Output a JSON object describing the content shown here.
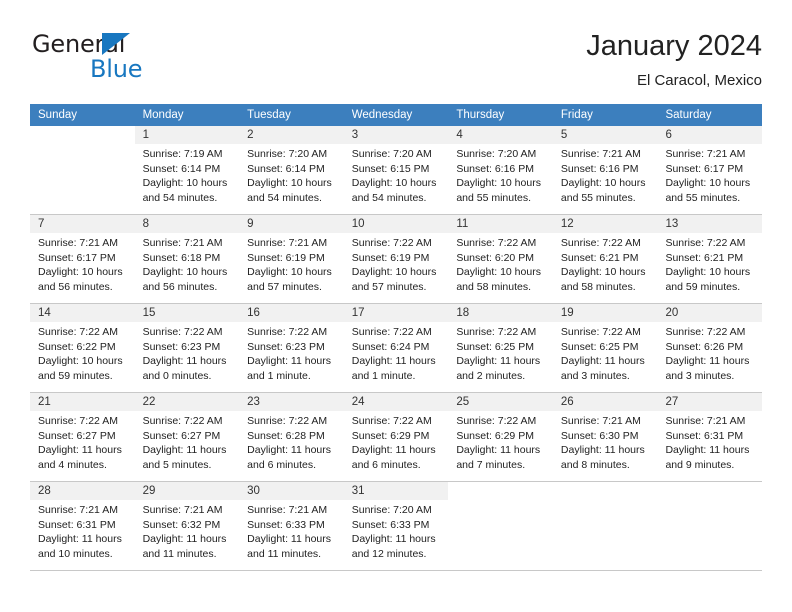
{
  "brand": {
    "word_one": "General",
    "word_two": "Blue",
    "accent_color": "#1877c0",
    "dark_color": "#231f20"
  },
  "header": {
    "title": "January 2024",
    "subtitle": "El Caracol, Mexico",
    "header_bg_color": "#3c7fbe",
    "daynum_bg_color": "#f1f1f1"
  },
  "weekdays": [
    "Sunday",
    "Monday",
    "Tuesday",
    "Wednesday",
    "Thursday",
    "Friday",
    "Saturday"
  ],
  "weeks": [
    [
      {
        "day": "",
        "sunrise": "",
        "sunset": "",
        "daylight1": "",
        "daylight2": ""
      },
      {
        "day": "1",
        "sunrise": "Sunrise: 7:19 AM",
        "sunset": "Sunset: 6:14 PM",
        "daylight1": "Daylight: 10 hours",
        "daylight2": "and 54 minutes."
      },
      {
        "day": "2",
        "sunrise": "Sunrise: 7:20 AM",
        "sunset": "Sunset: 6:14 PM",
        "daylight1": "Daylight: 10 hours",
        "daylight2": "and 54 minutes."
      },
      {
        "day": "3",
        "sunrise": "Sunrise: 7:20 AM",
        "sunset": "Sunset: 6:15 PM",
        "daylight1": "Daylight: 10 hours",
        "daylight2": "and 54 minutes."
      },
      {
        "day": "4",
        "sunrise": "Sunrise: 7:20 AM",
        "sunset": "Sunset: 6:16 PM",
        "daylight1": "Daylight: 10 hours",
        "daylight2": "and 55 minutes."
      },
      {
        "day": "5",
        "sunrise": "Sunrise: 7:21 AM",
        "sunset": "Sunset: 6:16 PM",
        "daylight1": "Daylight: 10 hours",
        "daylight2": "and 55 minutes."
      },
      {
        "day": "6",
        "sunrise": "Sunrise: 7:21 AM",
        "sunset": "Sunset: 6:17 PM",
        "daylight1": "Daylight: 10 hours",
        "daylight2": "and 55 minutes."
      }
    ],
    [
      {
        "day": "7",
        "sunrise": "Sunrise: 7:21 AM",
        "sunset": "Sunset: 6:17 PM",
        "daylight1": "Daylight: 10 hours",
        "daylight2": "and 56 minutes."
      },
      {
        "day": "8",
        "sunrise": "Sunrise: 7:21 AM",
        "sunset": "Sunset: 6:18 PM",
        "daylight1": "Daylight: 10 hours",
        "daylight2": "and 56 minutes."
      },
      {
        "day": "9",
        "sunrise": "Sunrise: 7:21 AM",
        "sunset": "Sunset: 6:19 PM",
        "daylight1": "Daylight: 10 hours",
        "daylight2": "and 57 minutes."
      },
      {
        "day": "10",
        "sunrise": "Sunrise: 7:22 AM",
        "sunset": "Sunset: 6:19 PM",
        "daylight1": "Daylight: 10 hours",
        "daylight2": "and 57 minutes."
      },
      {
        "day": "11",
        "sunrise": "Sunrise: 7:22 AM",
        "sunset": "Sunset: 6:20 PM",
        "daylight1": "Daylight: 10 hours",
        "daylight2": "and 58 minutes."
      },
      {
        "day": "12",
        "sunrise": "Sunrise: 7:22 AM",
        "sunset": "Sunset: 6:21 PM",
        "daylight1": "Daylight: 10 hours",
        "daylight2": "and 58 minutes."
      },
      {
        "day": "13",
        "sunrise": "Sunrise: 7:22 AM",
        "sunset": "Sunset: 6:21 PM",
        "daylight1": "Daylight: 10 hours",
        "daylight2": "and 59 minutes."
      }
    ],
    [
      {
        "day": "14",
        "sunrise": "Sunrise: 7:22 AM",
        "sunset": "Sunset: 6:22 PM",
        "daylight1": "Daylight: 10 hours",
        "daylight2": "and 59 minutes."
      },
      {
        "day": "15",
        "sunrise": "Sunrise: 7:22 AM",
        "sunset": "Sunset: 6:23 PM",
        "daylight1": "Daylight: 11 hours",
        "daylight2": "and 0 minutes."
      },
      {
        "day": "16",
        "sunrise": "Sunrise: 7:22 AM",
        "sunset": "Sunset: 6:23 PM",
        "daylight1": "Daylight: 11 hours",
        "daylight2": "and 1 minute."
      },
      {
        "day": "17",
        "sunrise": "Sunrise: 7:22 AM",
        "sunset": "Sunset: 6:24 PM",
        "daylight1": "Daylight: 11 hours",
        "daylight2": "and 1 minute."
      },
      {
        "day": "18",
        "sunrise": "Sunrise: 7:22 AM",
        "sunset": "Sunset: 6:25 PM",
        "daylight1": "Daylight: 11 hours",
        "daylight2": "and 2 minutes."
      },
      {
        "day": "19",
        "sunrise": "Sunrise: 7:22 AM",
        "sunset": "Sunset: 6:25 PM",
        "daylight1": "Daylight: 11 hours",
        "daylight2": "and 3 minutes."
      },
      {
        "day": "20",
        "sunrise": "Sunrise: 7:22 AM",
        "sunset": "Sunset: 6:26 PM",
        "daylight1": "Daylight: 11 hours",
        "daylight2": "and 3 minutes."
      }
    ],
    [
      {
        "day": "21",
        "sunrise": "Sunrise: 7:22 AM",
        "sunset": "Sunset: 6:27 PM",
        "daylight1": "Daylight: 11 hours",
        "daylight2": "and 4 minutes."
      },
      {
        "day": "22",
        "sunrise": "Sunrise: 7:22 AM",
        "sunset": "Sunset: 6:27 PM",
        "daylight1": "Daylight: 11 hours",
        "daylight2": "and 5 minutes."
      },
      {
        "day": "23",
        "sunrise": "Sunrise: 7:22 AM",
        "sunset": "Sunset: 6:28 PM",
        "daylight1": "Daylight: 11 hours",
        "daylight2": "and 6 minutes."
      },
      {
        "day": "24",
        "sunrise": "Sunrise: 7:22 AM",
        "sunset": "Sunset: 6:29 PM",
        "daylight1": "Daylight: 11 hours",
        "daylight2": "and 6 minutes."
      },
      {
        "day": "25",
        "sunrise": "Sunrise: 7:22 AM",
        "sunset": "Sunset: 6:29 PM",
        "daylight1": "Daylight: 11 hours",
        "daylight2": "and 7 minutes."
      },
      {
        "day": "26",
        "sunrise": "Sunrise: 7:21 AM",
        "sunset": "Sunset: 6:30 PM",
        "daylight1": "Daylight: 11 hours",
        "daylight2": "and 8 minutes."
      },
      {
        "day": "27",
        "sunrise": "Sunrise: 7:21 AM",
        "sunset": "Sunset: 6:31 PM",
        "daylight1": "Daylight: 11 hours",
        "daylight2": "and 9 minutes."
      }
    ],
    [
      {
        "day": "28",
        "sunrise": "Sunrise: 7:21 AM",
        "sunset": "Sunset: 6:31 PM",
        "daylight1": "Daylight: 11 hours",
        "daylight2": "and 10 minutes."
      },
      {
        "day": "29",
        "sunrise": "Sunrise: 7:21 AM",
        "sunset": "Sunset: 6:32 PM",
        "daylight1": "Daylight: 11 hours",
        "daylight2": "and 11 minutes."
      },
      {
        "day": "30",
        "sunrise": "Sunrise: 7:21 AM",
        "sunset": "Sunset: 6:33 PM",
        "daylight1": "Daylight: 11 hours",
        "daylight2": "and 11 minutes."
      },
      {
        "day": "31",
        "sunrise": "Sunrise: 7:20 AM",
        "sunset": "Sunset: 6:33 PM",
        "daylight1": "Daylight: 11 hours",
        "daylight2": "and 12 minutes."
      },
      {
        "day": "",
        "sunrise": "",
        "sunset": "",
        "daylight1": "",
        "daylight2": ""
      },
      {
        "day": "",
        "sunrise": "",
        "sunset": "",
        "daylight1": "",
        "daylight2": ""
      },
      {
        "day": "",
        "sunrise": "",
        "sunset": "",
        "daylight1": "",
        "daylight2": ""
      }
    ]
  ]
}
